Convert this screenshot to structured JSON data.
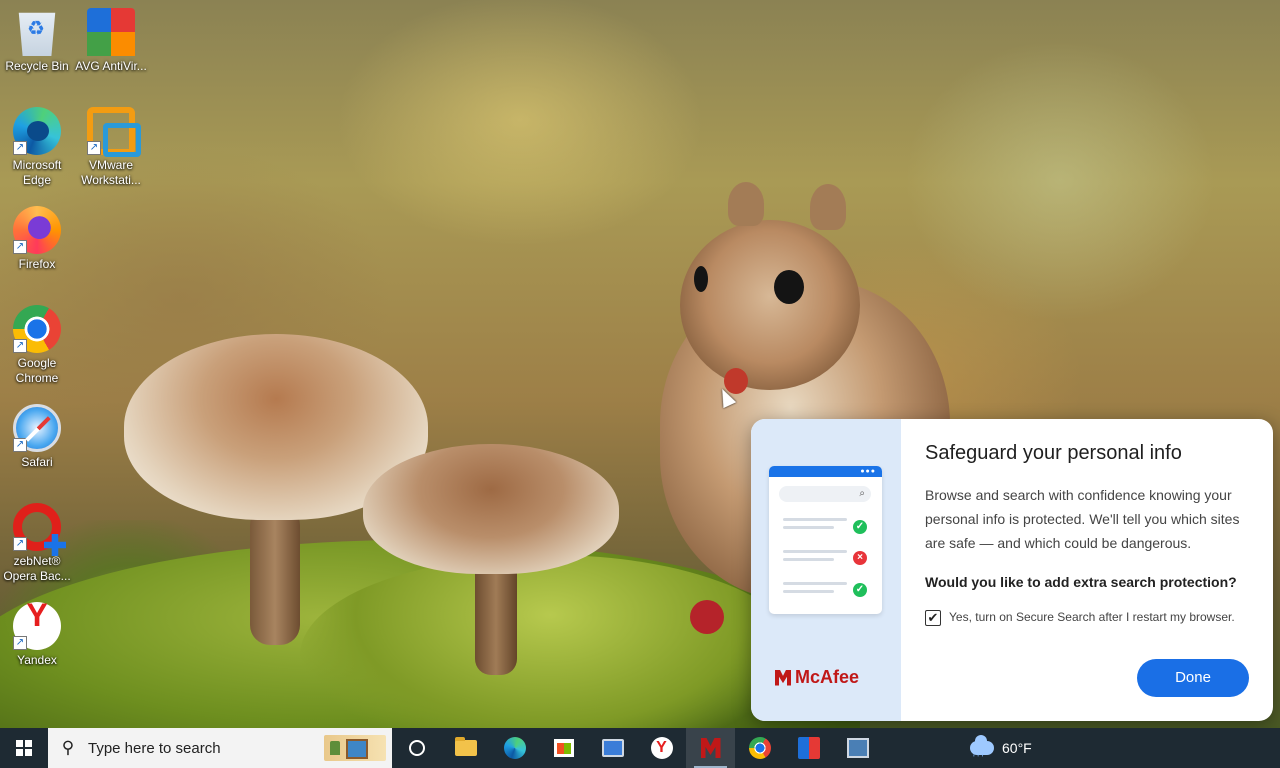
{
  "desktop": {
    "icons": [
      {
        "label": "Recycle Bin",
        "icon": "recycle-bin-icon"
      },
      {
        "label": "AVG AntiVir...",
        "icon": "avg-antivirus-icon"
      },
      {
        "label": "Microsoft Edge",
        "icon": "edge-icon"
      },
      {
        "label": "VMware Workstati...",
        "icon": "vmware-icon"
      },
      {
        "label": "Firefox",
        "icon": "firefox-icon"
      },
      {
        "label": "Google Chrome",
        "icon": "chrome-icon"
      },
      {
        "label": "Safari",
        "icon": "safari-icon"
      },
      {
        "label": "zebNet® Opera Bac...",
        "icon": "opera-backup-icon"
      },
      {
        "label": "Yandex",
        "icon": "yandex-icon"
      }
    ]
  },
  "popup": {
    "title": "Safeguard your personal info",
    "body": "Browse and search with confidence knowing your personal info is protected. We'll tell you which sites are safe — and which could be dangerous.",
    "question": "Would you like to add extra search protection?",
    "checkbox_label": "Yes, turn on Secure Search after I restart my browser.",
    "checkbox_checked": true,
    "done_label": "Done",
    "brand": "McAfee",
    "accent": "#1a6fe6",
    "brand_color": "#c01818"
  },
  "taskbar": {
    "search_placeholder": "Type here to search",
    "apps": [
      "cortana",
      "file-explorer",
      "edge",
      "microsoft-store",
      "remote-desktop",
      "yandex",
      "mcafee",
      "chrome",
      "avg",
      "control-panel"
    ],
    "active_app": "mcafee",
    "weather": "60°F"
  }
}
